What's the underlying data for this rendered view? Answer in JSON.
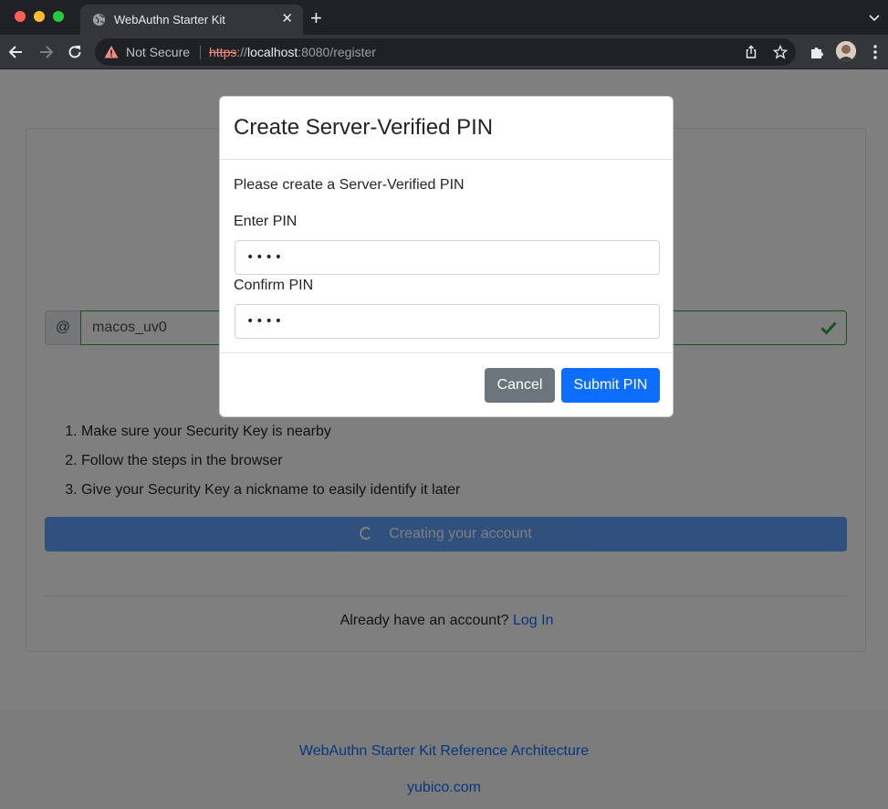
{
  "browser": {
    "tab_title": "WebAuthn Starter Kit",
    "tab_close": "✕",
    "new_tab": "+",
    "security_label": "Not Secure",
    "url_scheme": "https",
    "url_sep": "://",
    "url_host": "localhost",
    "url_rest": ":8080/register"
  },
  "form": {
    "at_symbol": "@",
    "username": "macos_uv0",
    "username_valid": true,
    "steps": [
      "Make sure your Security Key is nearby",
      "Follow the steps in the browser",
      "Give your Security Key a nickname to easily identify it later"
    ],
    "create_button_label": "Creating your account",
    "already_text": "Already have an account? ",
    "login_link": "Log In"
  },
  "footer": {
    "reference_link": "WebAuthn Starter Kit Reference Architecture",
    "site_link": "yubico.com"
  },
  "modal": {
    "title": "Create Server-Verified PIN",
    "description": "Please create a Server-Verified PIN",
    "enter_label": "Enter PIN",
    "enter_value": "••••",
    "confirm_label": "Confirm PIN",
    "confirm_value": "••••",
    "cancel_label": "Cancel",
    "submit_label": "Submit PIN"
  },
  "colors": {
    "primary": "#0d6efd",
    "secondary": "#6c757d",
    "valid": "#28a745",
    "browser_dark": "#202124",
    "browser_tab": "#35363a"
  },
  "icons": [
    "globe-icon",
    "back-arrow-icon",
    "forward-arrow-icon",
    "reload-icon",
    "warning-icon",
    "share-icon",
    "star-icon",
    "puzzle-icon",
    "kebab-icon",
    "check-icon",
    "spinner-icon"
  ]
}
